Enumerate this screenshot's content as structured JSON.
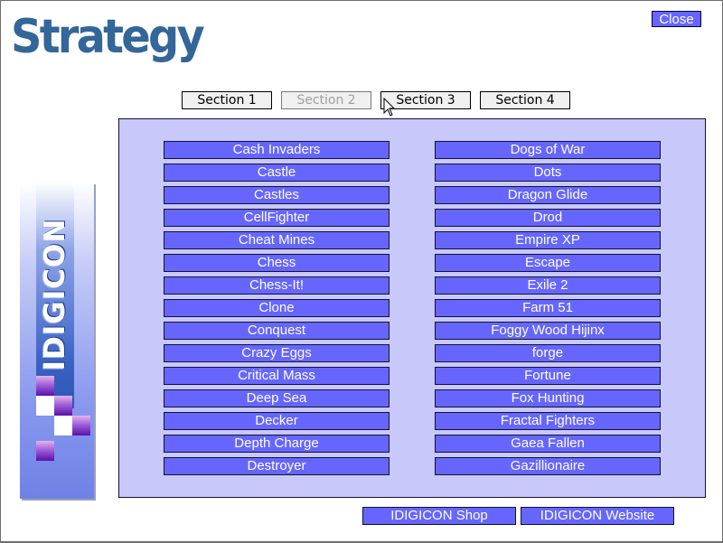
{
  "page": {
    "title": "Strategy",
    "close_label": "Close"
  },
  "sections": [
    {
      "label": "Section 1",
      "state": "enabled"
    },
    {
      "label": "Section 2",
      "state": "disabled"
    },
    {
      "label": "Section 3",
      "state": "enabled"
    },
    {
      "label": "Section 4",
      "state": "enabled"
    }
  ],
  "logo": {
    "text": "IDIGICON"
  },
  "games": {
    "left_column": [
      "Cash Invaders",
      "Castle",
      "Castles",
      "CellFighter",
      "Cheat Mines",
      "Chess",
      "Chess-It!",
      "Clone",
      "Conquest",
      "Crazy Eggs",
      "Critical Mass",
      "Deep Sea",
      "Decker",
      "Depth Charge",
      "Destroyer"
    ],
    "right_column": [
      "Dogs of War",
      "Dots",
      "Dragon Glide",
      "Drod",
      "Empire XP",
      "Escape",
      "Exile 2",
      "Farm 51",
      "Foggy Wood Hijinx",
      "forge",
      "Fortune",
      "Fox Hunting",
      "Fractal Fighters",
      "Gaea Fallen",
      "Gazillionaire"
    ]
  },
  "footer": {
    "shop_label": "IDIGICON Shop",
    "website_label": "IDIGICON Website"
  },
  "colors": {
    "title": "#336699",
    "button_bg": "#6666ff",
    "panel_bg": "#c8c8fa",
    "disabled_text": "#a0a0a0"
  }
}
